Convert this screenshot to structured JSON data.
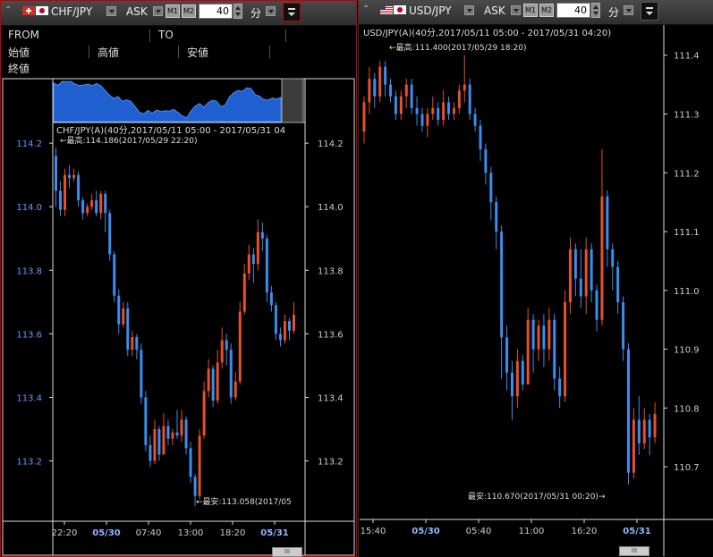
{
  "left": {
    "symbol": "CHF/JPY",
    "price_side": "ASK",
    "m1_label": "M1",
    "m2_label": "M2",
    "interval_value": "40",
    "interval_unit": "分",
    "info": {
      "from_label": "FROM",
      "to_label": "TO",
      "open_label": "始値",
      "high_label": "高値",
      "low_label": "安値",
      "close_label": "終値"
    },
    "chart_title": "CHF/JPY(A)(40分,2017/05/11 05:00 - 2017/05/31 04",
    "high_annotation": "←最高:114.186(2017/05/29 22:20)",
    "low_annotation": "←最安:113.058(2017/05",
    "y_ticks": [
      "114.2",
      "114.0",
      "113.8",
      "113.6",
      "113.4",
      "113.2"
    ],
    "x_ticks": [
      "22:20",
      "05/30",
      "07:40",
      "13:00",
      "18:20",
      "05/31"
    ],
    "scrollbar_label": "III"
  },
  "right": {
    "symbol": "USD/JPY",
    "price_side": "ASK",
    "m1_label": "M1",
    "m2_label": "M2",
    "interval_value": "40",
    "interval_unit": "分",
    "chart_title": "USD/JPY(A)(40分,2017/05/11 05:00 - 2017/05/31 04:20)",
    "high_annotation": "←最高:111.400(2017/05/29 18:20)",
    "low_annotation": "最安:110.670(2017/05/31 00:20)→",
    "y_ticks": [
      "111.4",
      "111.3",
      "111.2",
      "111.1",
      "111.0",
      "110.9",
      "110.8",
      "110.7"
    ],
    "x_ticks": [
      "15:40",
      "05/30",
      "05:40",
      "11:00",
      "16:20",
      "05/31"
    ],
    "scrollbar_label": "III"
  },
  "colors": {
    "up": "#e8502a",
    "down": "#3a8ef0",
    "axis_text_left": "#6699ff",
    "axis_text": "#cccccc",
    "date_tick": "#8fb4ff",
    "border_active": "#c00000"
  },
  "chart_data": [
    {
      "type": "candlestick",
      "title": "CHF/JPY(A)(40分,2017/05/11 05:00 - 2017/05/31 04",
      "ylim": [
        113.03,
        114.22
      ],
      "y_ticks": [
        114.2,
        114.0,
        113.8,
        113.6,
        113.4,
        113.2
      ],
      "x_ticks": [
        "22:20",
        "05/30",
        "07:40",
        "13:00",
        "18:20",
        "05/31"
      ],
      "high": 114.186,
      "low": 113.058,
      "candles": [
        [
          114.16,
          114.05,
          114.186,
          114.0
        ],
        [
          114.05,
          113.99,
          114.08,
          113.97
        ],
        [
          113.99,
          114.1,
          114.12,
          113.97
        ],
        [
          114.1,
          114.09,
          114.13,
          114.06
        ],
        [
          114.09,
          114.1,
          114.12,
          114.08
        ],
        [
          114.1,
          114.02,
          114.11,
          114.0
        ],
        [
          114.02,
          113.98,
          114.03,
          113.96
        ],
        [
          113.98,
          114.0,
          114.01,
          113.97
        ],
        [
          114.0,
          114.02,
          114.04,
          113.99
        ],
        [
          114.02,
          113.98,
          114.05,
          113.97
        ],
        [
          113.98,
          114.04,
          114.05,
          113.96
        ],
        [
          114.04,
          113.98,
          114.05,
          113.92
        ],
        [
          113.98,
          113.85,
          113.99,
          113.83
        ],
        [
          113.85,
          113.72,
          113.86,
          113.7
        ],
        [
          113.72,
          113.63,
          113.74,
          113.6
        ],
        [
          113.63,
          113.68,
          113.7,
          113.62
        ],
        [
          113.68,
          113.55,
          113.7,
          113.53
        ],
        [
          113.55,
          113.59,
          113.61,
          113.53
        ],
        [
          113.59,
          113.55,
          113.6,
          113.52
        ],
        [
          113.55,
          113.4,
          113.57,
          113.38
        ],
        [
          113.4,
          113.25,
          113.42,
          113.23
        ],
        [
          113.25,
          113.2,
          113.28,
          113.18
        ],
        [
          113.2,
          113.3,
          113.33,
          113.19
        ],
        [
          113.3,
          113.22,
          113.31,
          113.2
        ],
        [
          113.22,
          113.31,
          113.35,
          113.22
        ],
        [
          113.31,
          113.27,
          113.33,
          113.25
        ],
        [
          113.27,
          113.29,
          113.3,
          113.25
        ],
        [
          113.29,
          113.28,
          113.36,
          113.27
        ],
        [
          113.28,
          113.33,
          113.36,
          113.26
        ],
        [
          113.33,
          113.24,
          113.34,
          113.22
        ],
        [
          113.24,
          113.15,
          113.26,
          113.13
        ],
        [
          113.15,
          113.09,
          113.16,
          113.058
        ],
        [
          113.09,
          113.28,
          113.3,
          113.08
        ],
        [
          113.28,
          113.42,
          113.45,
          113.27
        ],
        [
          113.42,
          113.49,
          113.52,
          113.4
        ],
        [
          113.49,
          113.39,
          113.5,
          113.37
        ],
        [
          113.39,
          113.51,
          113.55,
          113.38
        ],
        [
          113.51,
          113.58,
          113.62,
          113.49
        ],
        [
          113.58,
          113.55,
          113.6,
          113.5
        ],
        [
          113.55,
          113.4,
          113.57,
          113.38
        ],
        [
          113.4,
          113.45,
          113.48,
          113.39
        ],
        [
          113.45,
          113.67,
          113.7,
          113.44
        ],
        [
          113.67,
          113.79,
          113.82,
          113.66
        ],
        [
          113.79,
          113.85,
          113.88,
          113.77
        ],
        [
          113.85,
          113.82,
          113.87,
          113.76
        ],
        [
          113.82,
          113.92,
          113.96,
          113.8
        ],
        [
          113.92,
          113.9,
          113.95,
          113.86
        ],
        [
          113.9,
          113.73,
          113.91,
          113.7
        ],
        [
          113.73,
          113.69,
          113.75,
          113.67
        ],
        [
          113.69,
          113.6,
          113.7,
          113.58
        ],
        [
          113.6,
          113.58,
          113.62,
          113.56
        ],
        [
          113.58,
          113.64,
          113.66,
          113.57
        ],
        [
          113.64,
          113.61,
          113.65,
          113.58
        ],
        [
          113.61,
          113.66,
          113.7,
          113.6
        ]
      ]
    },
    {
      "type": "candlestick",
      "title": "USD/JPY(A)(40分,2017/05/11 05:00 - 2017/05/31 04:20)",
      "ylim": [
        110.65,
        111.43
      ],
      "y_ticks": [
        111.4,
        111.3,
        111.2,
        111.1,
        111.0,
        110.9,
        110.8,
        110.7
      ],
      "x_ticks": [
        "15:40",
        "05/30",
        "05:40",
        "11:00",
        "16:20",
        "05/31"
      ],
      "high": 111.4,
      "low": 110.67,
      "candles": [
        [
          111.27,
          111.32,
          111.33,
          111.25
        ],
        [
          111.32,
          111.36,
          111.38,
          111.3
        ],
        [
          111.36,
          111.33,
          111.37,
          111.31
        ],
        [
          111.33,
          111.38,
          111.39,
          111.32
        ],
        [
          111.38,
          111.35,
          111.39,
          111.33
        ],
        [
          111.35,
          111.33,
          111.36,
          111.32
        ],
        [
          111.33,
          111.3,
          111.34,
          111.29
        ],
        [
          111.3,
          111.33,
          111.34,
          111.29
        ],
        [
          111.33,
          111.35,
          111.36,
          111.31
        ],
        [
          111.35,
          111.31,
          111.36,
          111.3
        ],
        [
          111.31,
          111.3,
          111.33,
          111.28
        ],
        [
          111.3,
          111.28,
          111.31,
          111.27
        ],
        [
          111.28,
          111.3,
          111.31,
          111.26
        ],
        [
          111.3,
          111.31,
          111.33,
          111.29
        ],
        [
          111.31,
          111.29,
          111.32,
          111.28
        ],
        [
          111.29,
          111.32,
          111.34,
          111.28
        ],
        [
          111.32,
          111.3,
          111.33,
          111.29
        ],
        [
          111.3,
          111.31,
          111.32,
          111.29
        ],
        [
          111.31,
          111.34,
          111.35,
          111.3
        ],
        [
          111.34,
          111.35,
          111.4,
          111.32
        ],
        [
          111.35,
          111.3,
          111.36,
          111.29
        ],
        [
          111.3,
          111.28,
          111.31,
          111.27
        ],
        [
          111.28,
          111.24,
          111.29,
          111.22
        ],
        [
          111.24,
          111.2,
          111.25,
          111.18
        ],
        [
          111.2,
          111.15,
          111.21,
          111.12
        ],
        [
          111.15,
          111.1,
          111.16,
          111.07
        ],
        [
          111.1,
          110.92,
          111.11,
          110.85
        ],
        [
          110.92,
          110.86,
          110.94,
          110.83
        ],
        [
          110.86,
          110.82,
          110.88,
          110.78
        ],
        [
          110.82,
          110.88,
          110.9,
          110.8
        ],
        [
          110.88,
          110.84,
          110.89,
          110.83
        ],
        [
          110.84,
          110.95,
          110.97,
          110.84
        ],
        [
          110.95,
          110.9,
          110.96,
          110.86
        ],
        [
          110.9,
          110.94,
          110.95,
          110.88
        ],
        [
          110.94,
          110.9,
          110.96,
          110.87
        ],
        [
          110.9,
          110.95,
          110.97,
          110.88
        ],
        [
          110.95,
          110.85,
          110.96,
          110.83
        ],
        [
          110.85,
          110.82,
          110.87,
          110.8
        ],
        [
          110.82,
          110.98,
          111.0,
          110.81
        ],
        [
          110.98,
          111.07,
          111.09,
          110.96
        ],
        [
          111.07,
          111.02,
          111.08,
          110.99
        ],
        [
          111.02,
          110.99,
          111.07,
          110.97
        ],
        [
          110.99,
          111.07,
          111.09,
          110.96
        ],
        [
          111.07,
          111.0,
          111.08,
          110.98
        ],
        [
          111.0,
          110.95,
          111.01,
          110.93
        ],
        [
          110.95,
          111.16,
          111.24,
          110.94
        ],
        [
          111.16,
          111.07,
          111.17,
          111.04
        ],
        [
          111.07,
          111.04,
          111.08,
          111.0
        ],
        [
          111.04,
          110.98,
          111.05,
          110.96
        ],
        [
          110.98,
          110.9,
          110.99,
          110.88
        ],
        [
          110.9,
          110.69,
          110.91,
          110.67
        ],
        [
          110.69,
          110.78,
          110.8,
          110.68
        ],
        [
          110.78,
          110.74,
          110.82,
          110.72
        ],
        [
          110.74,
          110.78,
          110.8,
          110.73
        ],
        [
          110.78,
          110.75,
          110.79,
          110.72
        ],
        [
          110.75,
          110.79,
          110.81,
          110.74
        ]
      ]
    }
  ]
}
